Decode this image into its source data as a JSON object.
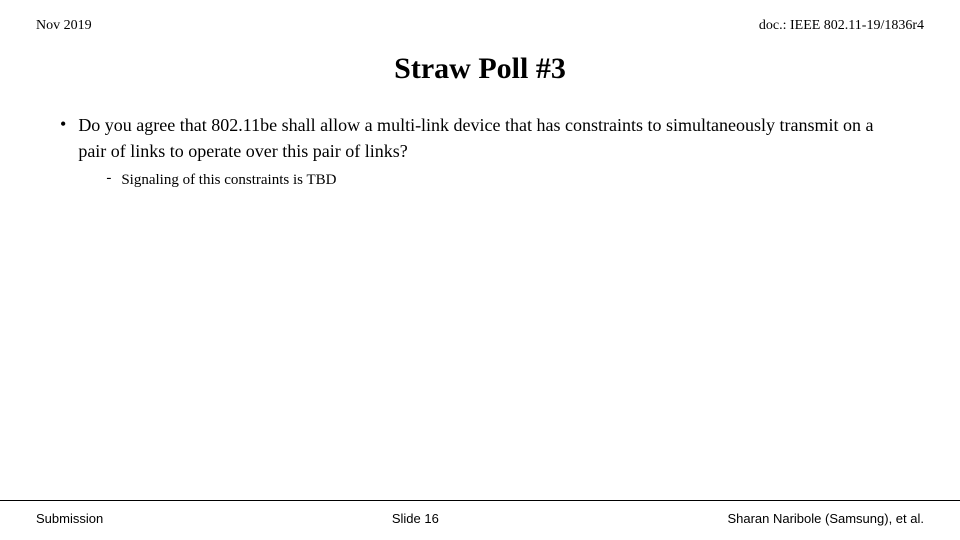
{
  "header": {
    "left": "Nov 2019",
    "right": "doc.: IEEE 802.11-19/1836r4"
  },
  "title": "Straw Poll #3",
  "bullet": {
    "dot": "•",
    "text": "Do you agree that 802.11be shall allow a multi-link device that has constraints to simultaneously transmit on a pair of links to operate over this pair of links?"
  },
  "sub_bullet": {
    "dash": "-",
    "text": "Signaling of this constraints is TBD"
  },
  "footer": {
    "left": "Submission",
    "center": "Slide 16",
    "right": "Sharan Naribole (Samsung), et al."
  }
}
